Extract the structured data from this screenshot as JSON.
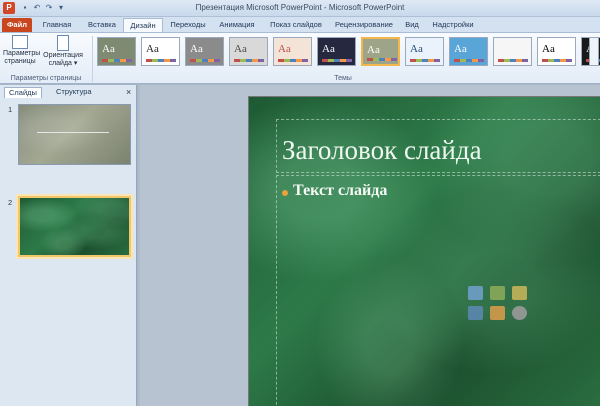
{
  "titlebar": {
    "app_icon_letter": "P",
    "title": "Презентация Microsoft PowerPoint - Microsoft PowerPoint",
    "qat_icons": [
      "save-icon",
      "undo-icon",
      "redo-icon",
      "customize-qat-icon"
    ]
  },
  "tabs": [
    {
      "label": "Файл"
    },
    {
      "label": "Главная"
    },
    {
      "label": "Вставка"
    },
    {
      "label": "Дизайн"
    },
    {
      "label": "Переходы"
    },
    {
      "label": "Анимация"
    },
    {
      "label": "Показ слайдов"
    },
    {
      "label": "Рецензирование"
    },
    {
      "label": "Вид"
    },
    {
      "label": "Надстройки"
    }
  ],
  "ribbon": {
    "page_setup": {
      "setup_label": "Параметры страницы",
      "setup_line1": "Параметры",
      "setup_line2": "страницы",
      "orientation_line1": "Ориентация",
      "orientation_line2": "слайда ▾",
      "group_label": "Параметры страницы"
    },
    "themes": {
      "group_label": "Темы",
      "items": [
        {
          "sample": "Aa",
          "bg": "#7f8a72",
          "fg": "#ffffff"
        },
        {
          "sample": "Aa",
          "bg": "#ffffff",
          "fg": "#1f1f1f"
        },
        {
          "sample": "Aa",
          "bg": "#8b8b8b",
          "fg": "#ffffff"
        },
        {
          "sample": "Aa",
          "bg": "#d9d9d9",
          "fg": "#4a4a4a"
        },
        {
          "sample": "Aa",
          "bg": "#f3e4d7",
          "fg": "#c0504d"
        },
        {
          "sample": "Aa",
          "bg": "#25283f",
          "fg": "#ffffff"
        },
        {
          "sample": "Aa",
          "bg": "#9ea487",
          "fg": "#ffffff"
        },
        {
          "sample": "Aa",
          "bg": "#eaf3fb",
          "fg": "#1f497d"
        },
        {
          "sample": "Aa",
          "bg": "#5aa5d8",
          "fg": "#ffffff"
        },
        {
          "sample": "",
          "bg": "#f6f6f6",
          "fg": "#9a0f10"
        },
        {
          "sample": "Aa",
          "bg": "#ffffff",
          "fg": "#000000"
        },
        {
          "sample": "Aa",
          "bg": "#1a1a1a",
          "fg": "#ffffff"
        }
      ]
    }
  },
  "panel": {
    "tab_slides": "Слайды",
    "tab_outline": "Структура",
    "close": "×",
    "slides": [
      {
        "number": "1"
      },
      {
        "number": "2"
      }
    ]
  },
  "slide": {
    "title": "Заголовок слайда",
    "body": "Текст слайда"
  },
  "colors": {
    "file_tab": "#c8471f",
    "selection": "#f2c66a",
    "bullet": "#e8a33c",
    "slide_green": "#1e5a34"
  }
}
